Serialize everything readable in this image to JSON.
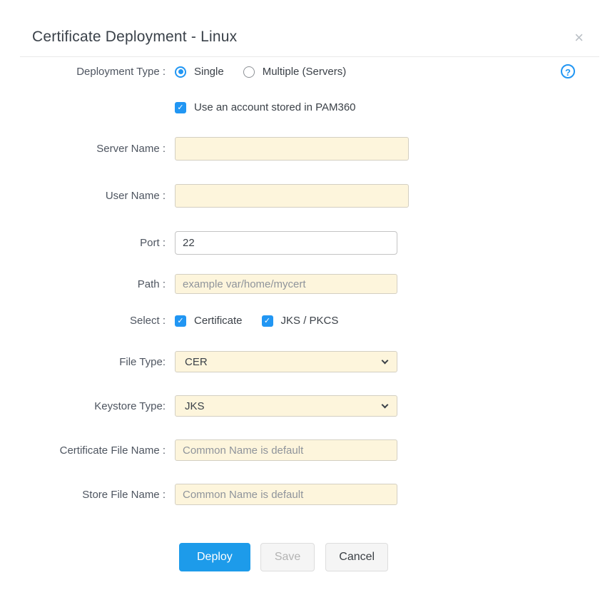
{
  "dialog": {
    "title": "Certificate Deployment - Linux",
    "close_glyph": "×"
  },
  "help": {
    "glyph": "?"
  },
  "form": {
    "deployment_type": {
      "label": "Deployment Type :",
      "single_label": "Single",
      "single_selected": true,
      "multiple_label": "Multiple (Servers)",
      "multiple_selected": false
    },
    "pam_account": {
      "label": "Use an account stored in PAM360",
      "checked": true,
      "check_glyph": "✓"
    },
    "server_name": {
      "label": "Server Name :",
      "value": ""
    },
    "user_name": {
      "label": "User Name :",
      "value": ""
    },
    "port": {
      "label": "Port :",
      "value": "22"
    },
    "path": {
      "label": "Path :",
      "placeholder": "example var/home/mycert"
    },
    "select_types": {
      "label": "Select :",
      "certificate_label": "Certificate",
      "certificate_checked": true,
      "jks_label": "JKS / PKCS",
      "jks_checked": true,
      "check_glyph": "✓"
    },
    "file_type": {
      "label": "File Type:",
      "value": "CER"
    },
    "keystore_type": {
      "label": "Keystore Type:",
      "value": "JKS"
    },
    "certificate_file_name": {
      "label": "Certificate File Name :",
      "placeholder": "Common Name is default"
    },
    "store_file_name": {
      "label": "Store File Name :",
      "placeholder": "Common Name is default"
    }
  },
  "buttons": {
    "deploy": "Deploy",
    "save": "Save",
    "cancel": "Cancel"
  },
  "colors": {
    "accent_blue": "#2196f3",
    "deploy_button_blue": "#1d9bea",
    "field_background_cream": "#fdf5dc"
  }
}
